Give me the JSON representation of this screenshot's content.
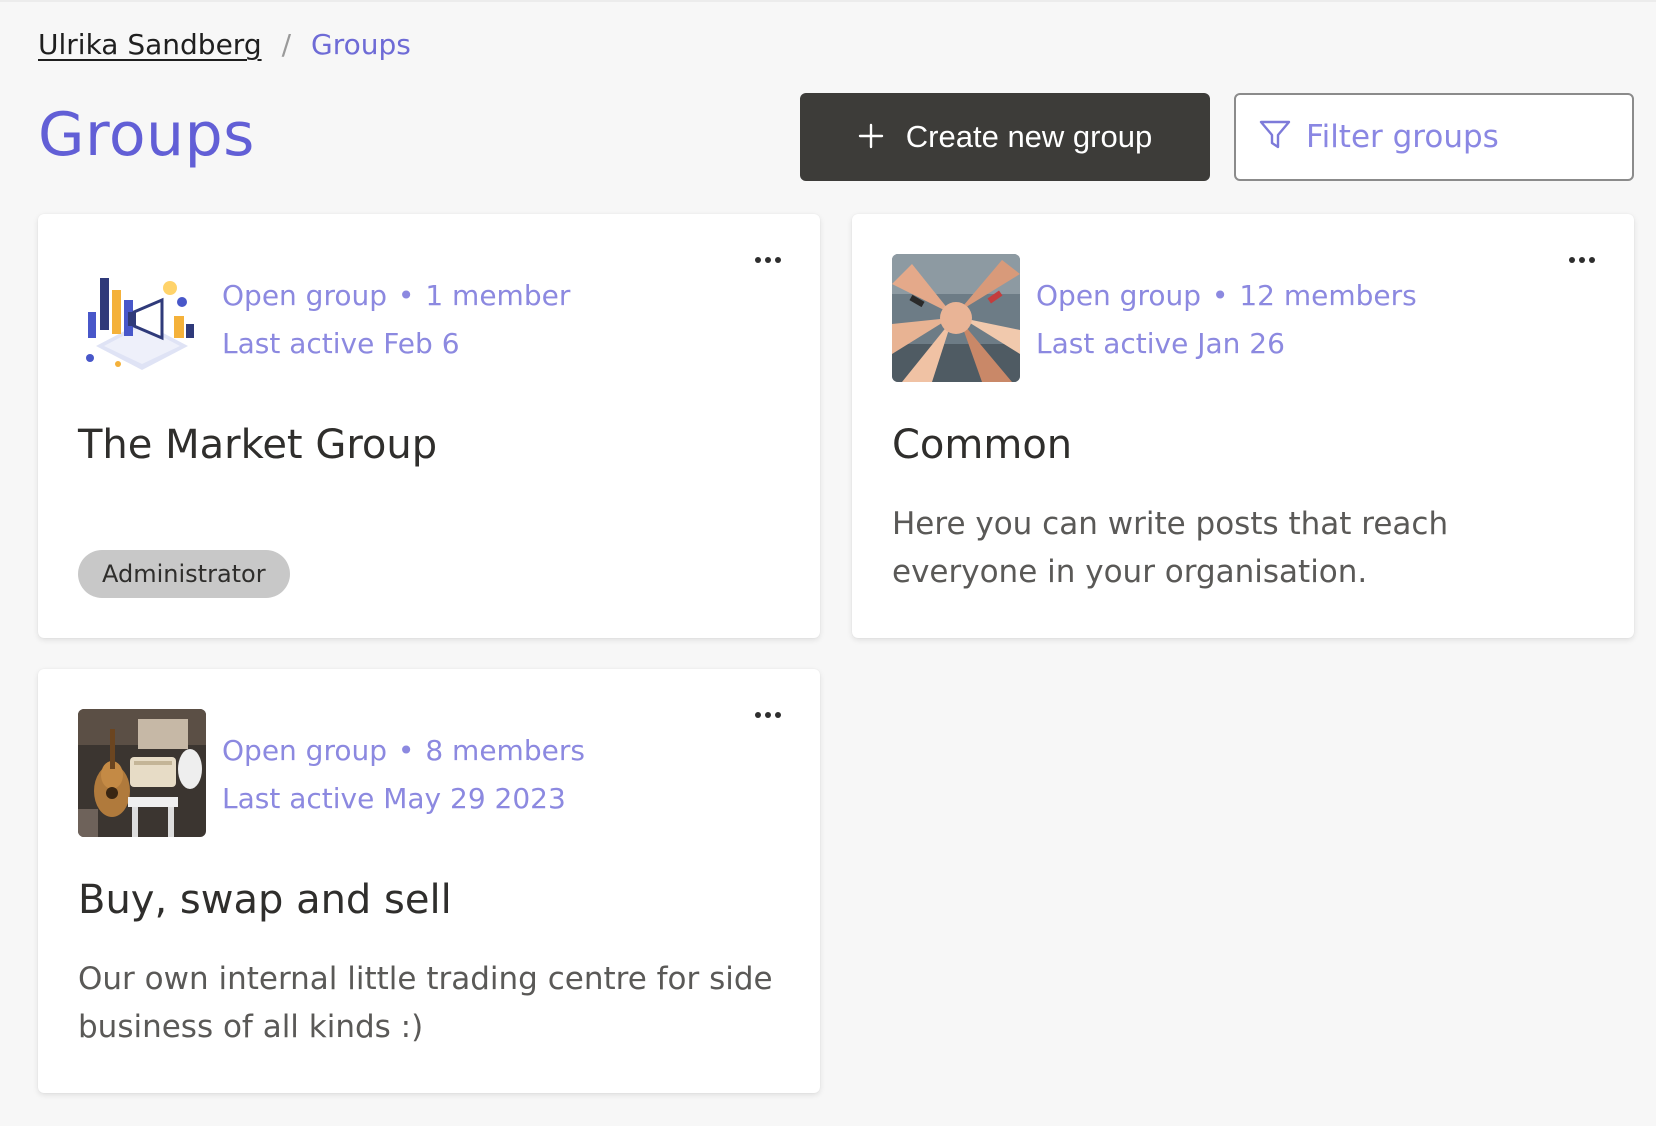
{
  "breadcrumb": {
    "user": "Ulrika Sandberg",
    "separator": "/",
    "current": "Groups"
  },
  "page": {
    "title": "Groups"
  },
  "toolbar": {
    "create_icon": "plus-icon",
    "create_label": "Create new group",
    "filter_icon": "filter-icon",
    "filter_placeholder": "Filter groups"
  },
  "colors": {
    "accent": "#625fd6",
    "meta_text": "#8c89e0",
    "button_dark": "#3d3c39",
    "badge_bg": "#c8c8c8",
    "page_bg": "#f7f7f7"
  },
  "groups": [
    {
      "type": "Open group",
      "separator": "•",
      "members": "1 member",
      "last_active": "Last active Feb 6",
      "name": "The Market Group",
      "description": "",
      "badge": "Administrator",
      "image": "market-illustration",
      "menu_icon": "more-options-icon"
    },
    {
      "type": "Open group",
      "separator": "•",
      "members": "12 members",
      "last_active": "Last active Jan 26",
      "name": "Common",
      "description": "Here you can write posts that reach everyone in your organisation.",
      "badge": "",
      "image": "hands-together-photo",
      "menu_icon": "more-options-icon"
    },
    {
      "type": "Open group",
      "separator": "•",
      "members": "8 members",
      "last_active": "Last active May 29 2023",
      "name": "Buy, swap and sell",
      "description": "Our own internal little trading centre for side business of all kinds :)",
      "badge": "",
      "image": "flea-market-photo",
      "menu_icon": "more-options-icon"
    }
  ]
}
